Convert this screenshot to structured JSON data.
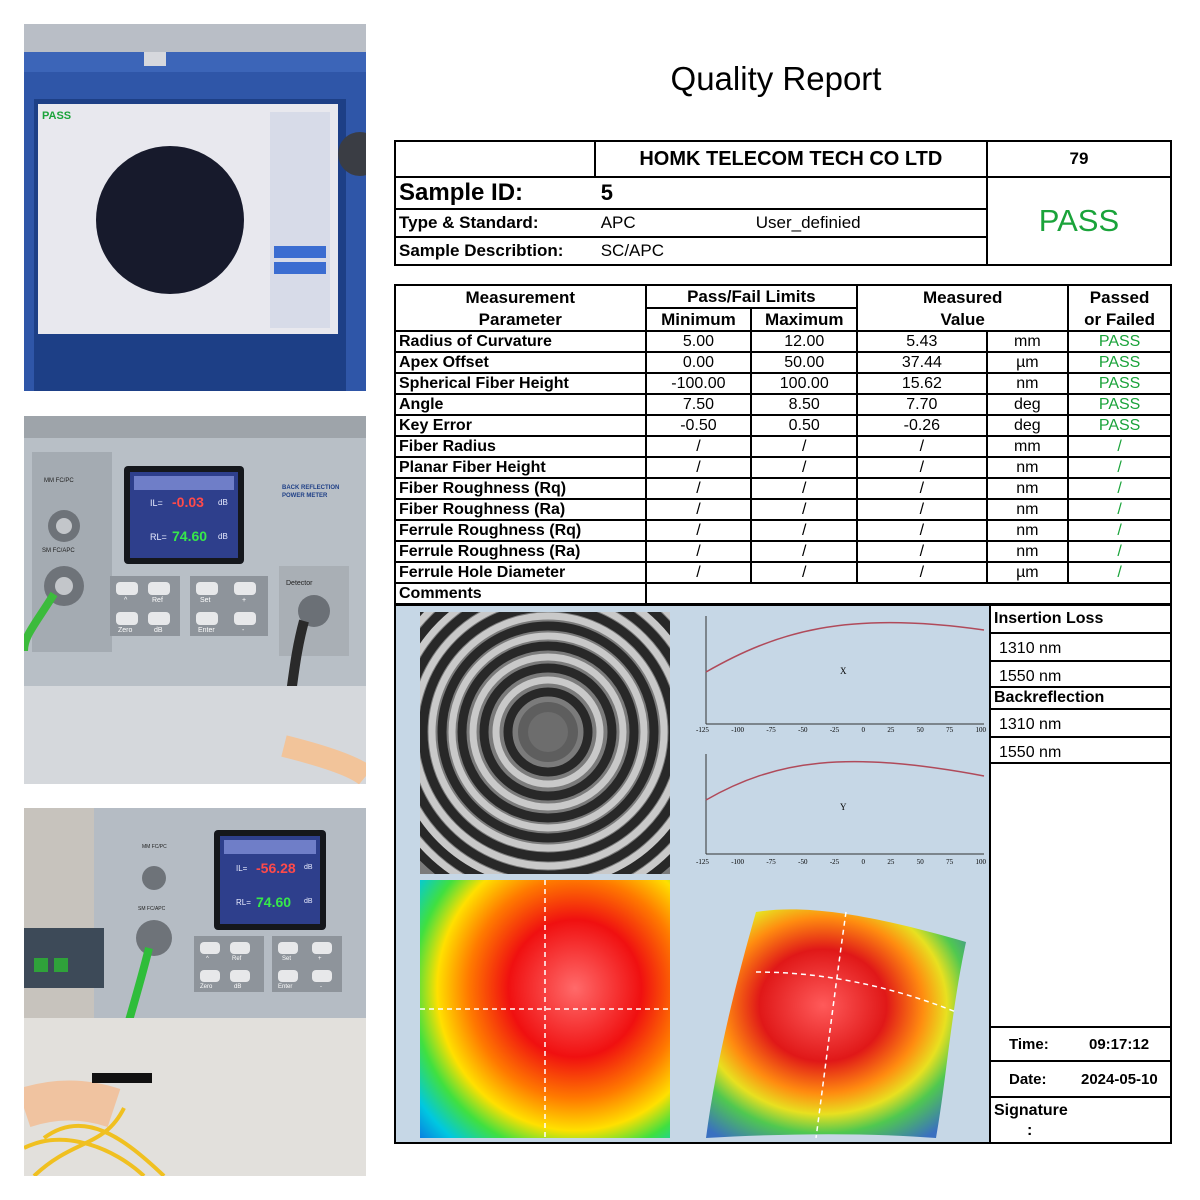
{
  "photos": {
    "photo1": {
      "screen_logo": "PASS"
    },
    "photo2": {
      "brand_text": "BACK REFLECTION POWER METER",
      "port_top": "MM FC/PC",
      "port_bottom": "SM FC/APC",
      "il_label": "IL=",
      "il_value": "-0.03",
      "rl_label": "RL=",
      "rl_value": "74.60",
      "unit": "dB",
      "detector_label": "Detector",
      "buttons": [
        "^",
        "Ref",
        "Zero",
        "dB",
        "Set",
        "+",
        "Enter",
        "-"
      ]
    },
    "photo3": {
      "port_top": "MM FC/PC",
      "port_bottom": "SM FC/APC",
      "il_label": "IL=",
      "il_value": "-56.28",
      "rl_label": "RL=",
      "rl_value": "74.60",
      "unit": "dB",
      "buttons": [
        "^",
        "Ref",
        "Zero",
        "dB",
        "Set",
        "+",
        "Enter",
        "-"
      ]
    }
  },
  "report": {
    "title": "Quality Report",
    "company": "HOMK TELECOM TECH CO LTD",
    "number": "79",
    "result": "PASS",
    "sample_id_label": "Sample  ID:",
    "sample_id": "5",
    "type_label": "Type & Standard:",
    "type_value": "APC",
    "standard_value": "User_definied",
    "desc_label": "Sample Describtion:",
    "desc_value": "SC/APC",
    "headers": {
      "param_1": "Measurement",
      "param_2": "Parameter",
      "limits": "Pass/Fail Limits",
      "minimum": "Minimum",
      "maximum": "Maximum",
      "measured_1": "Measured",
      "measured_2": "Value",
      "passed_1": "Passed",
      "passed_2": "or Failed"
    },
    "rows": [
      {
        "name": "Radius of Curvature",
        "min": "5.00",
        "max": "12.00",
        "value": "5.43",
        "unit": "mm",
        "result": "PASS"
      },
      {
        "name": "Apex Offset",
        "min": "0.00",
        "max": "50.00",
        "value": "37.44",
        "unit": "µm",
        "result": "PASS"
      },
      {
        "name": "Spherical Fiber Height",
        "min": "-100.00",
        "max": "100.00",
        "value": "15.62",
        "unit": "nm",
        "result": "PASS"
      },
      {
        "name": "Angle",
        "min": "7.50",
        "max": "8.50",
        "value": "7.70",
        "unit": "deg",
        "result": "PASS"
      },
      {
        "name": "Key Error",
        "min": "-0.50",
        "max": "0.50",
        "value": "-0.26",
        "unit": "deg",
        "result": "PASS"
      },
      {
        "name": "Fiber Radius",
        "min": "/",
        "max": "/",
        "value": "/",
        "unit": "mm",
        "result": "/"
      },
      {
        "name": "Planar Fiber Height",
        "min": "/",
        "max": "/",
        "value": "/",
        "unit": "nm",
        "result": "/"
      },
      {
        "name": "Fiber Roughness (Rq)",
        "min": "/",
        "max": "/",
        "value": "/",
        "unit": "nm",
        "result": "/"
      },
      {
        "name": "Fiber Roughness (Ra)",
        "min": "/",
        "max": "/",
        "value": "/",
        "unit": "nm",
        "result": "/"
      },
      {
        "name": "Ferrule Roughness (Rq)",
        "min": "/",
        "max": "/",
        "value": "/",
        "unit": "nm",
        "result": "/"
      },
      {
        "name": "Ferrule Roughness (Ra)",
        "min": "/",
        "max": "/",
        "value": "/",
        "unit": "nm",
        "result": "/"
      },
      {
        "name": "Ferrule Hole Diameter",
        "min": "/",
        "max": "/",
        "value": "/",
        "unit": "µm",
        "result": "/"
      }
    ],
    "comments_label": "Comments",
    "plots": {
      "x_label": "X",
      "y_label": "Y",
      "ticks": [
        "-125",
        "-100",
        "-75",
        "-50",
        "-25",
        "0",
        "25",
        "50",
        "75",
        "100"
      ]
    },
    "insertion_loss_label": "Insertion Loss",
    "backreflection_label": "Backreflection",
    "wl_1310": "1310  nm",
    "wl_1550": "1550  nm",
    "time_label": "Time:",
    "time_value": "09:17:12",
    "date_label": "Date:",
    "date_value": "2024-05-10",
    "signature_label": "Signature",
    "signature_colon": ":"
  }
}
